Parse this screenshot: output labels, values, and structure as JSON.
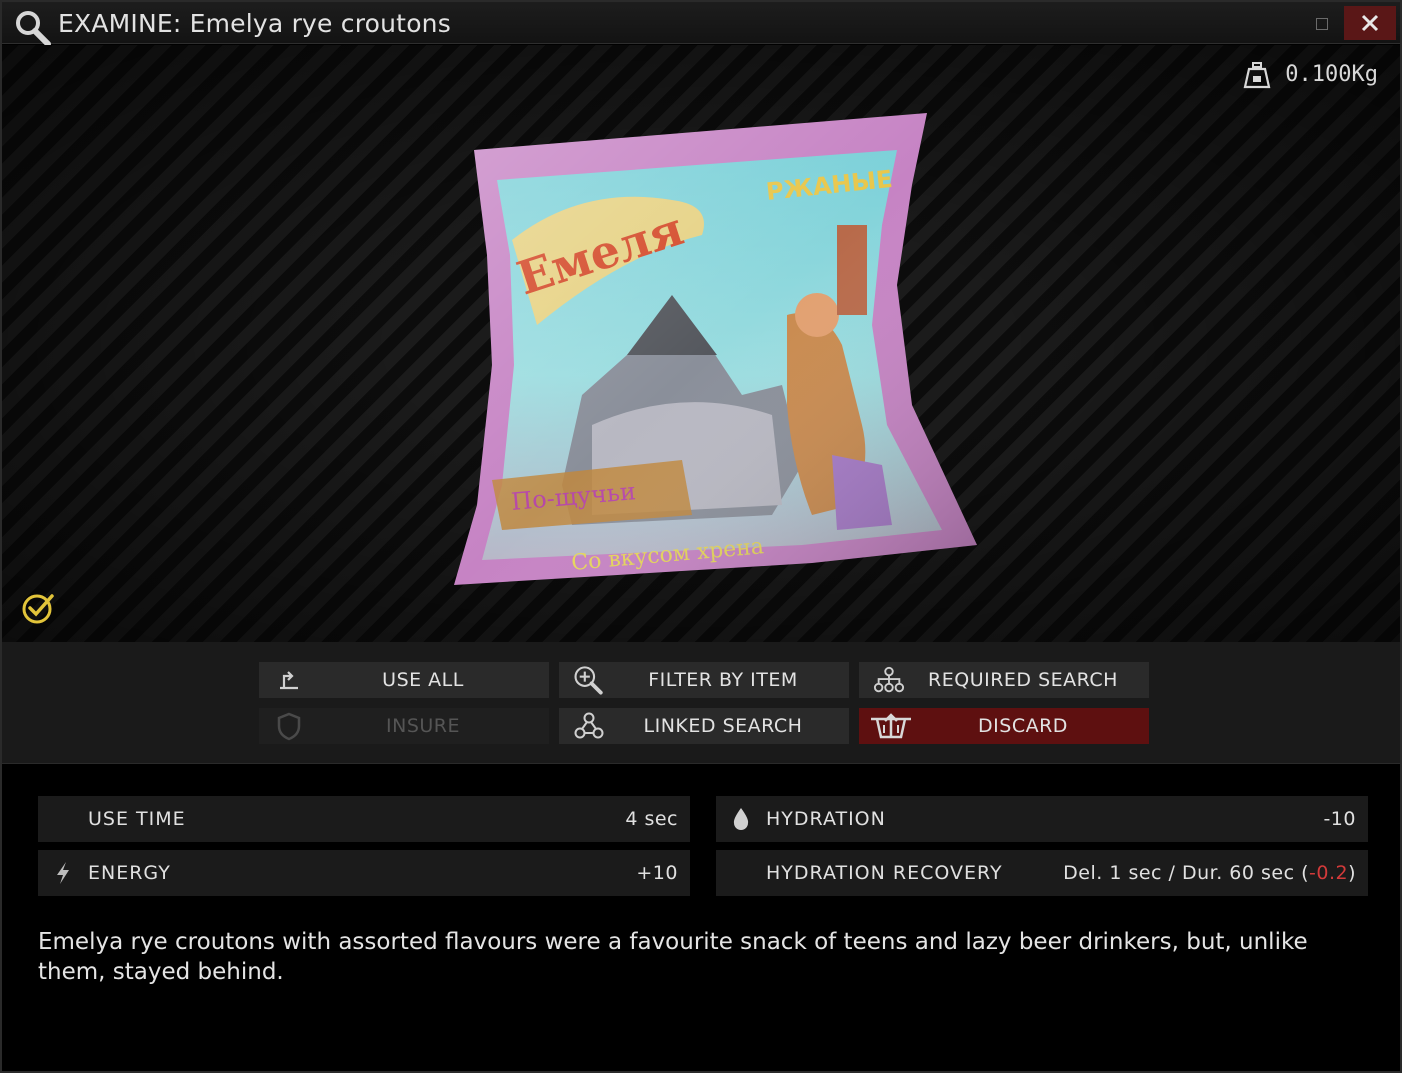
{
  "window": {
    "title": "EXAMINE: Emelya rye croutons"
  },
  "preview": {
    "weight": "0.100Kg",
    "item_image": "emelya-rye-croutons-bag"
  },
  "actions": {
    "use_all": "USE ALL",
    "filter_by_item": "FILTER BY ITEM",
    "required_search": "REQUIRED SEARCH",
    "insure": "INSURE",
    "linked_search": "LINKED SEARCH",
    "discard": "DISCARD"
  },
  "stats": {
    "use_time": {
      "label": "USE TIME",
      "value": "4 sec"
    },
    "energy": {
      "label": "ENERGY",
      "value": "+10"
    },
    "hydration": {
      "label": "HYDRATION",
      "value": "-10"
    },
    "hydration_recovery": {
      "label": "HYDRATION RECOVERY",
      "value_prefix": "Del. 1 sec / Dur. 60 sec (",
      "value_neg": "-0.2",
      "value_suffix": ")"
    }
  },
  "description": "Emelya rye croutons with assorted flavours were a favourite snack of teens and lazy beer drinkers, but, unlike them, stayed behind.",
  "colors": {
    "negative": "#d23a3a",
    "positive": "#4aa3df",
    "discard_bg": "#5e1010",
    "accent_yellow": "#e2c43a"
  }
}
